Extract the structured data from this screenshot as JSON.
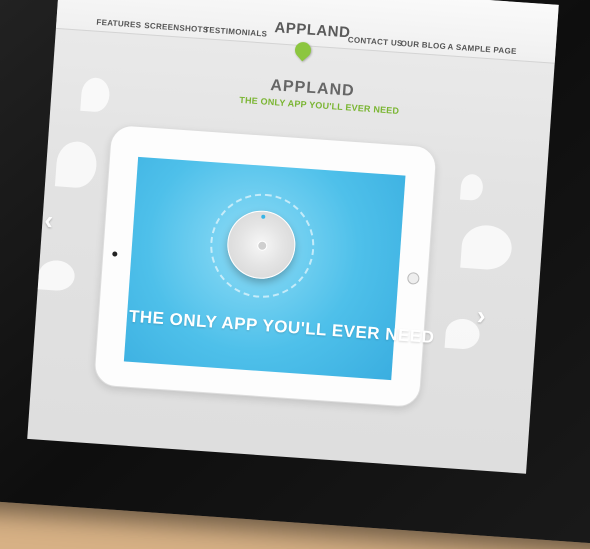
{
  "nav": {
    "features": "FEATURES",
    "screenshots": "SCREENSHOTS",
    "testimonials": "TESTIMONIALS",
    "logo": "APPLAND",
    "contact": "CONTACT US",
    "blog": "OUR BLOG",
    "sample": "A SAMPLE PAGE"
  },
  "hero": {
    "title": "APPLAND",
    "tagline": "THE ONLY APP YOU'LL EVER NEED"
  },
  "mockup": {
    "screen_text": "THE ONLY APP YOU'LL EVER NEED"
  },
  "colors": {
    "accent_green": "#8cc63f",
    "screen_blue": "#4ec0ea"
  }
}
